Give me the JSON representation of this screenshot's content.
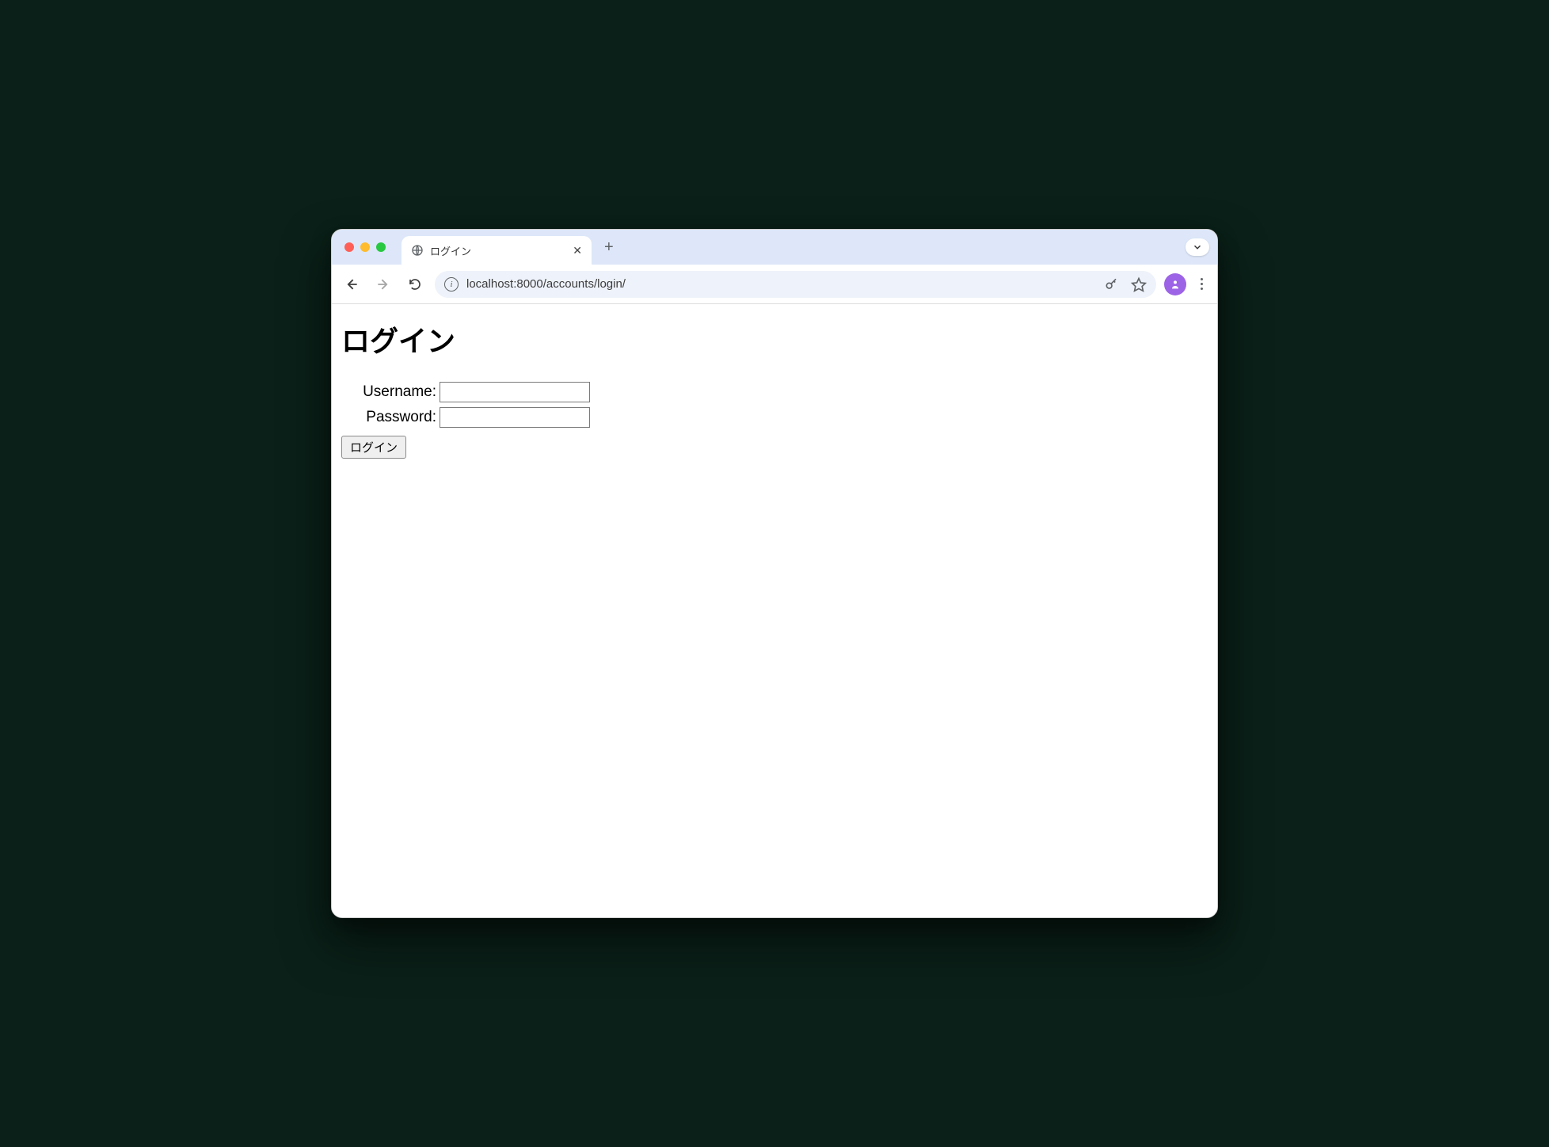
{
  "browser": {
    "tab_title": "ログイン",
    "url": "localhost:8000/accounts/login/"
  },
  "page": {
    "heading": "ログイン",
    "form": {
      "username_label": "Username:",
      "username_value": "",
      "password_label": "Password:",
      "password_value": "",
      "submit_label": "ログイン"
    }
  }
}
